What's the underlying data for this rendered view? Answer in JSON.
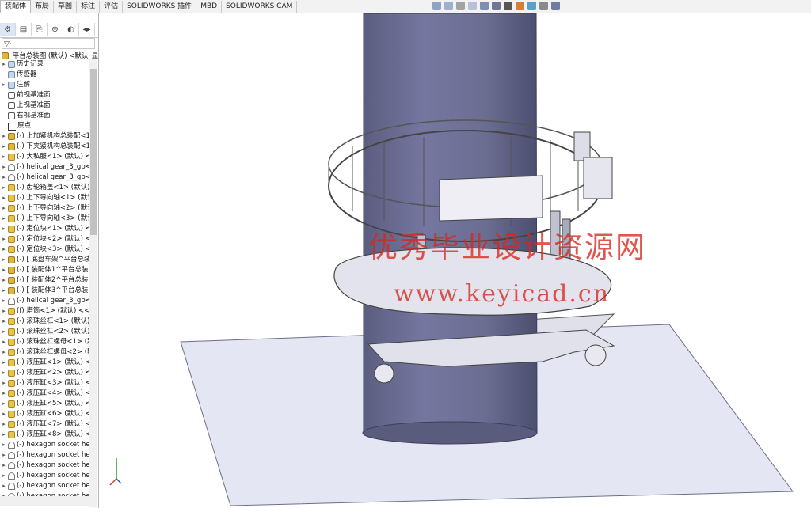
{
  "tabs": [
    "装配体",
    "布局",
    "草图",
    "标注",
    "评估",
    "SOLIDWORKS 插件",
    "MBD",
    "SOLIDWORKS CAM"
  ],
  "active_tab": "装配体",
  "feature_tree": {
    "root": "平台总装图 (默认) <默认_显",
    "items": [
      {
        "label": "历史记录",
        "icon": "folder-icon",
        "expand": true
      },
      {
        "label": "传感器",
        "icon": "folder-icon",
        "expand": false
      },
      {
        "label": "注解",
        "icon": "folder-icon",
        "expand": true
      },
      {
        "label": "前视基准面",
        "icon": "plane-icon",
        "expand": false
      },
      {
        "label": "上视基准面",
        "icon": "plane-icon",
        "expand": false
      },
      {
        "label": "右视基准面",
        "icon": "plane-icon",
        "expand": false
      },
      {
        "label": "原点",
        "icon": "origin-icon",
        "expand": false
      },
      {
        "label": "(-) 上加紧机构总装配<1",
        "icon": "assembly-icon",
        "expand": true
      },
      {
        "label": "(-) 下夹紧机构总装配<1",
        "icon": "assembly-icon",
        "expand": true
      },
      {
        "label": "(-) 大私服<1> (默认) <",
        "icon": "part-icon",
        "expand": true
      },
      {
        "label": "(-) helical gear_3_gb<",
        "icon": "toolbox-icon",
        "expand": true
      },
      {
        "label": "(-) helical gear_3_gb<",
        "icon": "toolbox-icon",
        "expand": true
      },
      {
        "label": "(-) 齿轮箱盖<1> (默认)",
        "icon": "part-icon",
        "expand": true
      },
      {
        "label": "(-) 上下导向轴<1> (默认",
        "icon": "part-icon",
        "expand": true
      },
      {
        "label": "(-) 上下导向轴<2> (默认",
        "icon": "part-icon",
        "expand": true
      },
      {
        "label": "(-) 上下导向轴<3> (默认",
        "icon": "part-icon",
        "expand": true
      },
      {
        "label": "(-) 定位块<1> (默认) <",
        "icon": "part-icon",
        "expand": true
      },
      {
        "label": "(-) 定位块<2> (默认) <",
        "icon": "part-icon",
        "expand": true
      },
      {
        "label": "(-) 定位块<3> (默认) <",
        "icon": "part-icon",
        "expand": true
      },
      {
        "label": "(-) [ 底盘车架^平台总装",
        "icon": "assembly-icon",
        "expand": true
      },
      {
        "label": "(-) [ 装配体1^平台总装图",
        "icon": "assembly-icon",
        "expand": true
      },
      {
        "label": "(-) [ 装配体2^平台总装图",
        "icon": "assembly-icon",
        "expand": true
      },
      {
        "label": "(-) [ 装配体3^平台总装图",
        "icon": "assembly-icon",
        "expand": true
      },
      {
        "label": "(-) helical gear_3_gb<",
        "icon": "toolbox-icon",
        "expand": true
      },
      {
        "label": "(f) 塔筒<1> (默认) <<默",
        "icon": "part-icon",
        "expand": true
      },
      {
        "label": "(-) 滚珠丝杠<1> (默认)",
        "icon": "part-icon",
        "expand": true
      },
      {
        "label": "(-) 滚珠丝杠<2> (默认) <",
        "icon": "part-icon",
        "expand": true
      },
      {
        "label": "(-) 滚珠丝杠螺母<1> (默",
        "icon": "part-icon",
        "expand": true
      },
      {
        "label": "(-) 滚珠丝杠螺母<2> (默",
        "icon": "part-icon",
        "expand": true
      },
      {
        "label": "(-) 液压缸<1> (默认) <",
        "icon": "part-icon",
        "expand": true
      },
      {
        "label": "(-) 液压缸<2> (默认) <",
        "icon": "part-icon",
        "expand": true
      },
      {
        "label": "(-) 液压缸<3> (默认) <",
        "icon": "part-icon",
        "expand": true
      },
      {
        "label": "(-) 液压缸<4> (默认) <",
        "icon": "part-icon",
        "expand": true
      },
      {
        "label": "(-) 液压缸<5> (默认) <",
        "icon": "part-icon",
        "expand": true
      },
      {
        "label": "(-) 液压缸<6> (默认) <",
        "icon": "part-icon",
        "expand": true
      },
      {
        "label": "(-) 液压缸<7> (默认) <",
        "icon": "part-icon",
        "expand": true
      },
      {
        "label": "(-) 液压缸<8> (默认) <",
        "icon": "part-icon",
        "expand": true
      },
      {
        "label": "(-) hexagon socket he",
        "icon": "toolbox-icon",
        "expand": true
      },
      {
        "label": "(-) hexagon socket he",
        "icon": "toolbox-icon",
        "expand": true
      },
      {
        "label": "(-) hexagon socket he",
        "icon": "toolbox-icon",
        "expand": true
      },
      {
        "label": "(-) hexagon socket he",
        "icon": "toolbox-icon",
        "expand": true
      },
      {
        "label": "(-) hexagon socket he",
        "icon": "toolbox-icon",
        "expand": true
      },
      {
        "label": "(-) hexagon socket he",
        "icon": "toolbox-icon",
        "expand": true
      }
    ]
  },
  "watermark": {
    "line1": "优秀毕业设计资源网",
    "line2": "www.keyicad.cn"
  },
  "colors": {
    "tower": "#6a6c8e",
    "platform": "#dfe0ea",
    "ground_plane": "#e4e6f3",
    "watermark": "#d6281e"
  }
}
